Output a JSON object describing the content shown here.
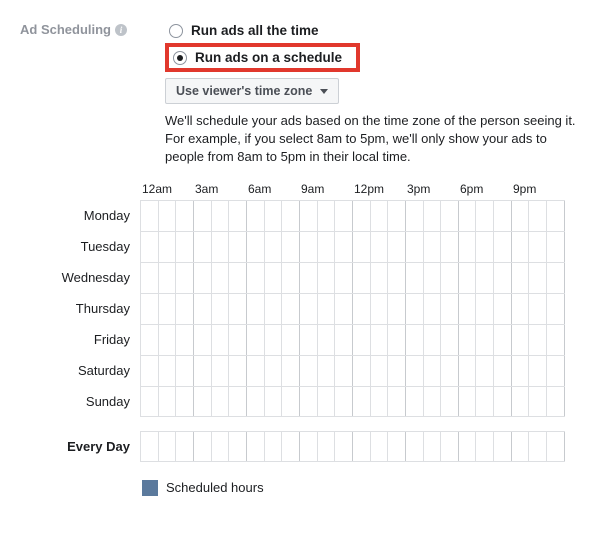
{
  "section_label": "Ad Scheduling",
  "radios": {
    "all_time": "Run ads all the time",
    "on_schedule": "Run ads on a schedule"
  },
  "timezone_selector": "Use viewer's time zone",
  "description_line1": "We'll schedule your ads based on the time zone of the person seeing it.",
  "description_line2": "For example, if you select 8am to 5pm, we'll only show your ads to people from 8am to 5pm in their local time.",
  "time_headers": [
    "12am",
    "3am",
    "6am",
    "9am",
    "12pm",
    "3pm",
    "6pm",
    "9pm"
  ],
  "days": [
    "Monday",
    "Tuesday",
    "Wednesday",
    "Thursday",
    "Friday",
    "Saturday",
    "Sunday"
  ],
  "every_day_label": "Every Day",
  "legend_label": "Scheduled hours"
}
